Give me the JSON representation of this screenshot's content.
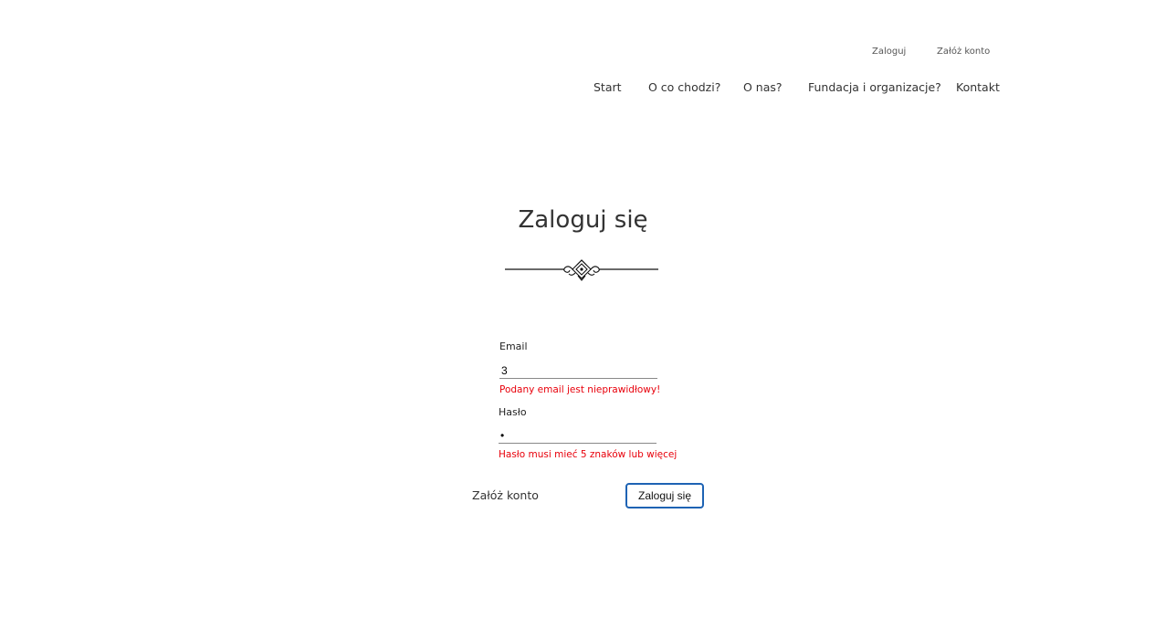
{
  "header": {
    "auth_links": {
      "login": "Zaloguj",
      "register": "Załóż konto"
    },
    "nav": [
      {
        "label": "Start"
      },
      {
        "label": "O co chodzi?"
      },
      {
        "label": "O nas?"
      },
      {
        "label": "Fundacja i organizacje?"
      },
      {
        "label": "Kontakt"
      }
    ]
  },
  "main": {
    "title": "Zaloguj się",
    "decoration_icon": "ornament-divider-icon",
    "form": {
      "email": {
        "label": "Email",
        "value": "3",
        "error": "Podany email jest nieprawidłowy!"
      },
      "password": {
        "label": "Hasło",
        "value": "•",
        "error": "Hasło musi mieć 5 znaków lub więcej"
      },
      "register_link": "Załóż konto",
      "submit_label": "Zaloguj się"
    }
  },
  "colors": {
    "error": "#e8000b",
    "button_border": "#1e63b4",
    "text": "#333333"
  }
}
